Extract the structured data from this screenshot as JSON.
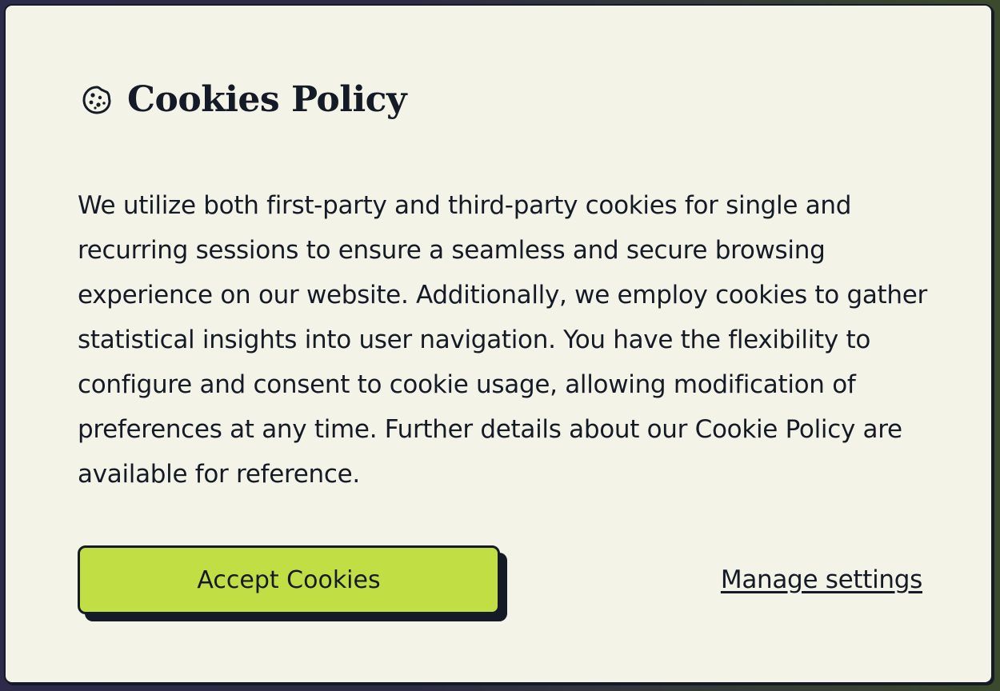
{
  "dialog": {
    "title": "Cookies Policy",
    "icon": "cookie-icon",
    "body": "We utilize both first-party and third-party cookies for single and recurring sessions to ensure a seamless and secure browsing experience on our website. Additionally, we employ cookies to gather statistical insights into user navigation. You have the flexibility to configure and consent to cookie usage, allowing modification of preferences at any time. Further details about our Cookie Policy are available for reference.",
    "accept_label": "Accept Cookies",
    "manage_label": "Manage settings"
  },
  "colors": {
    "background": "#f4f3e7",
    "text": "#141a26",
    "accent": "#c2de45"
  }
}
